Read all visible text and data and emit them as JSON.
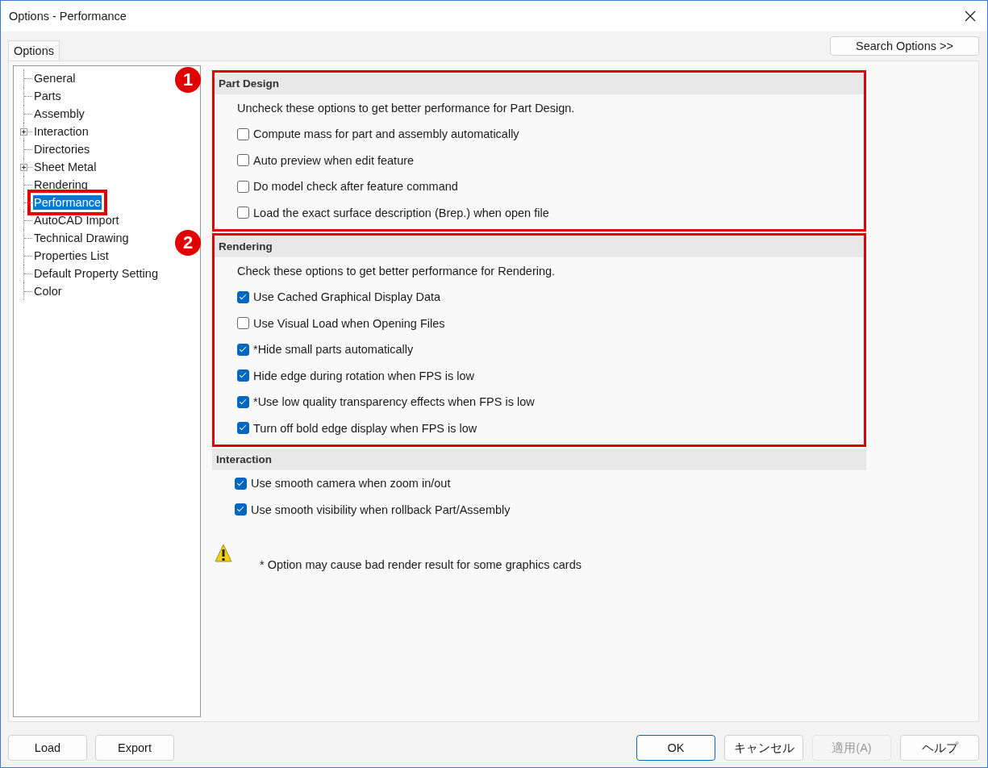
{
  "window": {
    "title": "Options - Performance"
  },
  "tabs": [
    {
      "label": "Options",
      "selected": true
    }
  ],
  "search_button": "Search Options >>",
  "tree": [
    {
      "label": "General",
      "kind": "leaf",
      "selected": false,
      "highlighted": false
    },
    {
      "label": "Parts",
      "kind": "leaf",
      "selected": false,
      "highlighted": false
    },
    {
      "label": "Assembly",
      "kind": "leaf",
      "selected": false,
      "highlighted": false
    },
    {
      "label": "Interaction",
      "kind": "collapsed",
      "selected": false,
      "highlighted": false
    },
    {
      "label": "Directories",
      "kind": "leaf",
      "selected": false,
      "highlighted": false
    },
    {
      "label": "Sheet Metal",
      "kind": "collapsed",
      "selected": false,
      "highlighted": false
    },
    {
      "label": "Rendering",
      "kind": "leaf",
      "selected": false,
      "highlighted": false
    },
    {
      "label": "Performance",
      "kind": "leaf",
      "selected": true,
      "highlighted": true
    },
    {
      "label": "AutoCAD Import",
      "kind": "leaf",
      "selected": false,
      "highlighted": false
    },
    {
      "label": "Technical Drawing",
      "kind": "leaf",
      "selected": false,
      "highlighted": false
    },
    {
      "label": "Properties List",
      "kind": "leaf",
      "selected": false,
      "highlighted": false
    },
    {
      "label": "Default Property Setting",
      "kind": "leaf",
      "selected": false,
      "highlighted": false
    },
    {
      "label": "Color",
      "kind": "leaf",
      "selected": false,
      "highlighted": false
    }
  ],
  "sections": [
    {
      "title": "Part Design",
      "callout": "1",
      "description": "Uncheck these options to get better performance for Part Design.",
      "options": [
        {
          "label": "Compute mass for part and assembly automatically",
          "checked": false
        },
        {
          "label": "Auto preview when edit feature",
          "checked": false
        },
        {
          "label": "Do model check after feature command",
          "checked": false
        },
        {
          "label": "Load the exact surface description (Brep.) when open file",
          "checked": false
        }
      ]
    },
    {
      "title": "Rendering",
      "callout": "2",
      "description": "Check these options to get better performance for Rendering.",
      "options": [
        {
          "label": "Use Cached Graphical Display Data",
          "checked": true
        },
        {
          "label": "Use Visual Load when Opening Files",
          "checked": false
        },
        {
          "label": "*Hide small parts automatically",
          "checked": true
        },
        {
          "label": "Hide edge during rotation when FPS is low",
          "checked": true
        },
        {
          "label": "*Use low quality transparency effects when FPS is low",
          "checked": true
        },
        {
          "label": "Turn off bold edge display when FPS is low",
          "checked": true
        }
      ]
    },
    {
      "title": "Interaction",
      "options": [
        {
          "label": "Use smooth camera when zoom in/out",
          "checked": true
        },
        {
          "label": "Use smooth visibility when rollback Part/Assembly",
          "checked": true
        }
      ]
    }
  ],
  "note": "* Option may cause bad render result for some graphics cards",
  "left_buttons": [
    {
      "label": "Load",
      "disabled": false
    },
    {
      "label": "Export",
      "disabled": false
    }
  ],
  "right_buttons": [
    {
      "label": "OK",
      "disabled": false,
      "default": true
    },
    {
      "label": "キャンセル",
      "disabled": false,
      "default": false
    },
    {
      "label": "適用(A)",
      "disabled": true,
      "default": false
    },
    {
      "label": "ヘルプ",
      "disabled": false,
      "default": false
    }
  ]
}
